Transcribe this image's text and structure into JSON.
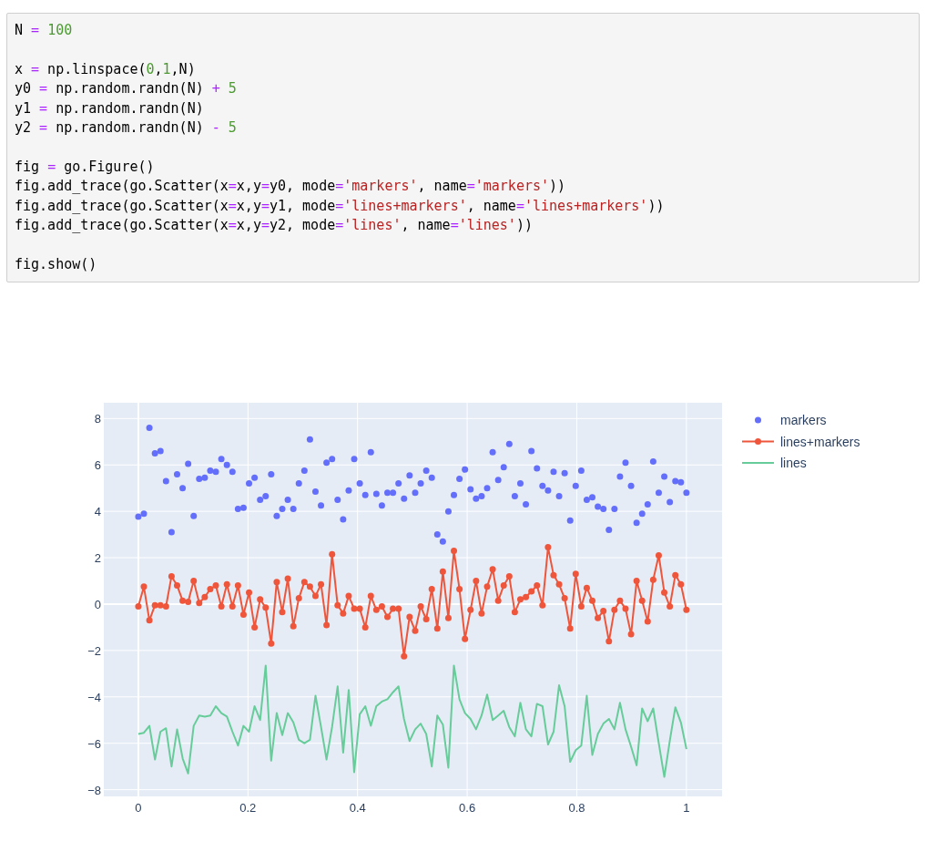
{
  "code_cell": {
    "blocks": [
      [
        "N = 100"
      ],
      [
        "x = np.linspace(0,1,N)",
        "y0 = np.random.randn(N) + 5",
        "y1 = np.random.randn(N)",
        "y2 = np.random.randn(N) - 5"
      ],
      [
        "fig = go.Figure()",
        "fig.add_trace(go.Scatter(x=x,y=y0, mode='markers', name='markers'))",
        "fig.add_trace(go.Scatter(x=x,y=y1, mode='lines+markers', name='lines+markers'))",
        "fig.add_trace(go.Scatter(x=x,y=y2, mode='lines', name='lines'))"
      ],
      [
        "fig.show()"
      ]
    ]
  },
  "output": {
    "chart_data": {
      "type": "line",
      "x": [
        0,
        0.0101,
        0.0202,
        0.0303,
        0.0404,
        0.0505,
        0.0606,
        0.0707,
        0.0808,
        0.0909,
        0.101,
        0.1111,
        0.1212,
        0.1313,
        0.1414,
        0.1515,
        0.1616,
        0.1717,
        0.1818,
        0.1919,
        0.202,
        0.2121,
        0.2222,
        0.2323,
        0.2424,
        0.2525,
        0.2626,
        0.2727,
        0.2828,
        0.2929,
        0.303,
        0.3131,
        0.3232,
        0.3333,
        0.3434,
        0.3535,
        0.3636,
        0.3737,
        0.3838,
        0.3939,
        0.404,
        0.4141,
        0.4242,
        0.4343,
        0.4444,
        0.4545,
        0.4646,
        0.4747,
        0.4848,
        0.4949,
        0.5051,
        0.5152,
        0.5253,
        0.5354,
        0.5455,
        0.5556,
        0.5657,
        0.5758,
        0.5859,
        0.596,
        0.6061,
        0.6162,
        0.6263,
        0.6364,
        0.6465,
        0.6566,
        0.6667,
        0.6768,
        0.6869,
        0.697,
        0.7071,
        0.7172,
        0.7273,
        0.7374,
        0.7475,
        0.7576,
        0.7677,
        0.7778,
        0.7879,
        0.798,
        0.8081,
        0.8182,
        0.8283,
        0.8384,
        0.8485,
        0.8586,
        0.8687,
        0.8788,
        0.8889,
        0.899,
        0.9091,
        0.9192,
        0.9293,
        0.9394,
        0.9495,
        0.9596,
        0.9697,
        0.9798,
        0.9899,
        1
      ],
      "series": [
        {
          "name": "markers",
          "type": "scatter",
          "color": "#636efa",
          "values": [
            3.77,
            3.9,
            7.6,
            6.5,
            6.6,
            5.3,
            3.1,
            5.6,
            5.0,
            6.05,
            3.8,
            5.4,
            5.45,
            5.75,
            5.7,
            6.25,
            6.0,
            5.7,
            4.1,
            4.15,
            5.2,
            5.45,
            4.5,
            4.65,
            5.6,
            3.8,
            4.1,
            4.5,
            4.1,
            5.2,
            5.75,
            7.1,
            4.85,
            4.25,
            6.1,
            6.25,
            4.5,
            3.65,
            4.9,
            6.25,
            5.2,
            4.7,
            6.55,
            4.75,
            4.25,
            4.8,
            4.8,
            5.2,
            4.55,
            5.55,
            4.8,
            5.2,
            5.75,
            5.45,
            3.0,
            2.7,
            4.0,
            4.7,
            5.4,
            5.8,
            4.95,
            4.55,
            4.65,
            5.0,
            6.55,
            5.35,
            5.9,
            6.9,
            4.65,
            5.2,
            4.3,
            6.6,
            5.85,
            5.1,
            4.9,
            5.7,
            4.65,
            5.65,
            3.6,
            5.1,
            5.75,
            4.5,
            4.6,
            4.2,
            4.1,
            3.2,
            4.1,
            5.5,
            6.1,
            5.1,
            3.5,
            3.9,
            4.3,
            6.15,
            4.8,
            5.5,
            4.4,
            5.3,
            5.25,
            4.8
          ]
        },
        {
          "name": "lines+markers",
          "marker": true,
          "color": "#ef553b",
          "values": [
            -0.1,
            0.75,
            -0.7,
            -0.05,
            -0.05,
            -0.1,
            1.2,
            0.8,
            0.15,
            0.1,
            1.0,
            0.05,
            0.3,
            0.65,
            0.8,
            -0.1,
            0.85,
            -0.1,
            0.8,
            -0.45,
            0.5,
            -1.0,
            0.2,
            -0.15,
            -1.7,
            0.95,
            -0.35,
            1.1,
            -0.95,
            0.25,
            0.95,
            0.75,
            0.35,
            0.85,
            -0.9,
            2.15,
            -0.05,
            -0.4,
            0.35,
            -0.2,
            -0.2,
            -1.0,
            0.35,
            -0.25,
            -0.1,
            -0.55,
            -0.2,
            -0.2,
            -2.25,
            -0.55,
            -1.15,
            -0.1,
            -0.65,
            0.65,
            -1.05,
            1.4,
            -0.6,
            2.3,
            0.65,
            -1.5,
            -0.25,
            1.0,
            -0.4,
            0.75,
            1.5,
            0.15,
            0.8,
            1.2,
            -0.35,
            0.2,
            0.3,
            0.55,
            0.8,
            -0.05,
            2.45,
            1.25,
            0.85,
            0.25,
            -1.05,
            1.3,
            -0.1,
            0.7,
            0.15,
            -0.6,
            -0.3,
            -1.6,
            -0.25,
            0.15,
            -0.2,
            -1.3,
            1.0,
            0.15,
            -0.75,
            1.05,
            2.1,
            0.5,
            -0.1,
            1.25,
            0.85,
            -0.25
          ]
        },
        {
          "name": "lines",
          "color": "#66cc99",
          "values": [
            -5.6,
            -5.55,
            -5.25,
            -6.7,
            -5.5,
            -5.35,
            -7.0,
            -5.4,
            -6.65,
            -7.3,
            -5.25,
            -4.8,
            -4.85,
            -4.8,
            -4.4,
            -4.7,
            -4.85,
            -5.5,
            -6.1,
            -5.25,
            -5.5,
            -4.4,
            -5.0,
            -2.65,
            -6.75,
            -4.7,
            -5.65,
            -4.7,
            -5.1,
            -5.85,
            -6.0,
            -5.85,
            -3.95,
            -5.3,
            -6.7,
            -5.3,
            -3.55,
            -6.4,
            -3.7,
            -7.25,
            -4.75,
            -4.4,
            -5.25,
            -4.4,
            -4.2,
            -4.1,
            -3.8,
            -3.55,
            -4.95,
            -5.9,
            -5.4,
            -5.15,
            -5.6,
            -7.0,
            -4.8,
            -5.2,
            -7.05,
            -2.65,
            -4.1,
            -4.7,
            -4.95,
            -5.4,
            -4.8,
            -3.9,
            -5.0,
            -4.8,
            -4.6,
            -5.3,
            -5.7,
            -4.25,
            -5.4,
            -5.7,
            -4.3,
            -4.4,
            -6.05,
            -5.5,
            -3.5,
            -4.4,
            -6.8,
            -6.3,
            -6.1,
            -3.95,
            -6.5,
            -5.6,
            -5.15,
            -4.95,
            -5.4,
            -4.25,
            -5.4,
            -6.15,
            -6.95,
            -4.5,
            -5.05,
            -4.5,
            -6.0,
            -7.45,
            -5.9,
            -4.45,
            -5.1,
            -6.25
          ]
        }
      ],
      "grid": true,
      "legend": "right",
      "xlim": [
        -0.063,
        1.065
      ],
      "ylim": [
        -8.29,
        8.68
      ],
      "xticks": [
        0,
        0.2,
        0.4,
        0.6,
        0.8,
        1
      ],
      "yticks": [
        {
          "value": -8,
          "label": "−8"
        },
        {
          "value": -6,
          "label": "−6"
        },
        {
          "value": -4,
          "label": "−4"
        },
        {
          "value": -2,
          "label": "−2"
        },
        0,
        2,
        4,
        6,
        8
      ]
    }
  }
}
